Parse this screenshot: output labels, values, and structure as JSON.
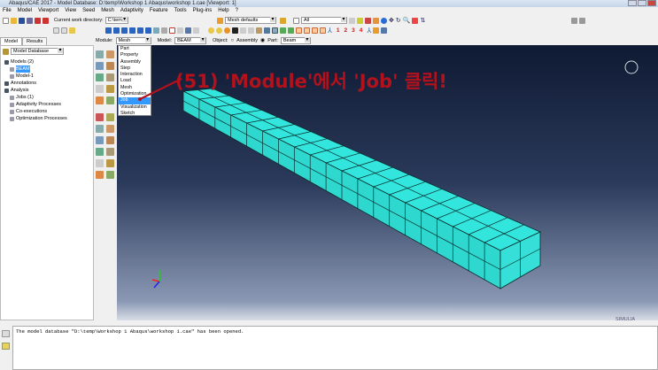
{
  "window": {
    "title": "Abaqus/CAE 2017 - Model Database: D:\\temp\\Workshop 1 Abaqus\\workshop 1.cae [Viewport: 1]"
  },
  "menu": [
    "File",
    "Model",
    "Viewport",
    "View",
    "Seed",
    "Mesh",
    "Adaptivity",
    "Feature",
    "Tools",
    "Plug-ins",
    "Help",
    "?"
  ],
  "toolbar": {
    "work_dir_label": "Current work directory:",
    "work_dir": "C:\\temp",
    "mesh_defaults": "Mesh defaults",
    "selection": "All",
    "view_numbers": [
      "1",
      "2",
      "3",
      "4"
    ]
  },
  "context": {
    "module_label": "Module:",
    "module": "Mesh",
    "model_label": "Model:",
    "model": "BEAM",
    "object_label": "Object:",
    "assembly_option": "Assembly",
    "part_option": "Part:",
    "part": "Beam",
    "object_selected": "Part"
  },
  "tabs": [
    "Model",
    "Results"
  ],
  "tree": {
    "root": "Model Database",
    "items": [
      {
        "label": "Models (2)",
        "indent": 0,
        "icon": "models-icon"
      },
      {
        "label": "BEAM",
        "indent": 1,
        "icon": "expand-icon",
        "selected": true
      },
      {
        "label": "Model-1",
        "indent": 1,
        "icon": "expand-icon"
      },
      {
        "label": "Annotations",
        "indent": 0,
        "icon": "annotations-icon"
      },
      {
        "label": "Analysis",
        "indent": 0,
        "icon": "analysis-icon"
      },
      {
        "label": "Jobs (1)",
        "indent": 1,
        "icon": "jobs-icon"
      },
      {
        "label": "Adaptivity Processes",
        "indent": 1,
        "icon": "adaptivity-icon"
      },
      {
        "label": "Co-executions",
        "indent": 1,
        "icon": "coexec-icon"
      },
      {
        "label": "Optimization Processes",
        "indent": 1,
        "icon": "optimization-icon"
      }
    ]
  },
  "module_dropdown": {
    "options": [
      "Part",
      "Property",
      "Assembly",
      "Step",
      "Interaction",
      "Load",
      "Mesh",
      "Optimization",
      "Job",
      "Visualization",
      "Sketch"
    ],
    "highlighted": "Job"
  },
  "annotation": "(51) 'Module'에서 'Job' 클릭!",
  "brand": "SIMULIA",
  "message": "The model database \"D:\\temp\\Workshop 1 Abaqus\\workshop 1.cae\" has been opened.",
  "colors": {
    "mesh": "#33e6dd",
    "annotation": "#b3121c",
    "selection": "#3399ff"
  }
}
